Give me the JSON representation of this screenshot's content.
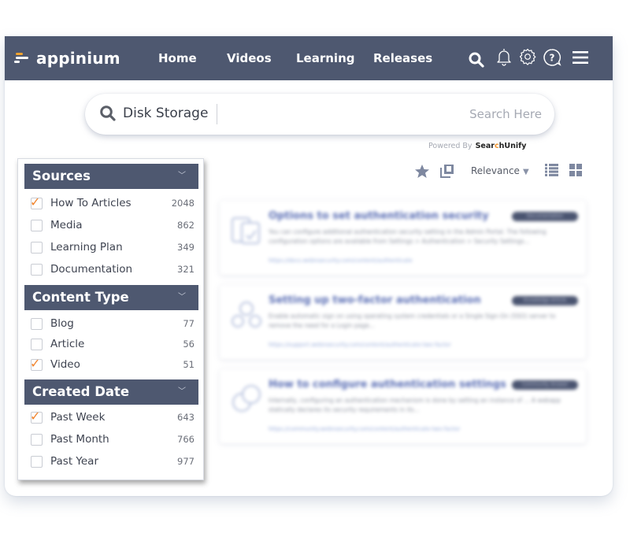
{
  "navbar": {
    "logo_text": "appinium",
    "links": [
      "Home",
      "Videos",
      "Learning",
      "Releases"
    ],
    "icons": [
      "search-icon",
      "bell-icon",
      "gear-icon",
      "help-icon",
      "menu-icon"
    ]
  },
  "search": {
    "value": "Disk Storage",
    "placeholder": "Search Here",
    "powered_by_label": "Powered By",
    "powered_by_brand_prefix": "Sear",
    "powered_by_brand_c": "c",
    "powered_by_brand_suffix": "hUnify"
  },
  "toolbar": {
    "icons": [
      "star-icon",
      "copy-icon",
      "list-view-icon",
      "grid-view-icon"
    ],
    "sort_label": "Relevance"
  },
  "filters": {
    "groups": [
      {
        "title": "Sources",
        "items": [
          {
            "label": "How To Articles",
            "count": "2048",
            "checked": true
          },
          {
            "label": "Media",
            "count": "862",
            "checked": false
          },
          {
            "label": "Learning Plan",
            "count": "349",
            "checked": false
          },
          {
            "label": "Documentation",
            "count": "321",
            "checked": false
          }
        ]
      },
      {
        "title": "Content Type",
        "items": [
          {
            "label": "Blog",
            "count": "77",
            "checked": false
          },
          {
            "label": "Article",
            "count": "56",
            "checked": false
          },
          {
            "label": "Video",
            "count": "51",
            "checked": true
          }
        ]
      },
      {
        "title": "Created Date",
        "items": [
          {
            "label": "Past Week",
            "count": "643",
            "checked": true
          },
          {
            "label": "Past Month",
            "count": "766",
            "checked": false
          },
          {
            "label": "Past Year",
            "count": "977",
            "checked": false
          }
        ]
      }
    ]
  },
  "results": [
    {
      "title": "Options to set authentication security",
      "badge": "Documentation",
      "description": "You can configure additional authentication security setting in the Admin Portal. The following configuration options are available from Settings > Authentication > Security Settings...",
      "link": "https://docs.webnsecurity.com/content/authenticate"
    },
    {
      "title": "Setting up two-factor authentication",
      "badge": "Knowledge Article",
      "description": "Enable automatic sign on using operating system credentials or a Single Sign-On (SSO) server to remove the need for a Login page...",
      "link": "https://support.webnsecurity.com/content/authenticate-two-factor"
    },
    {
      "title": "How to configure authentication settings",
      "badge": "Community Answer",
      "description": "Internally, configuring an authentication mechanism is done by setting an instance of ... A webapp statically declares its security requirements in its...",
      "link": "https://community.webnsecurity.com/content/authenticate-two-factor"
    }
  ],
  "colors": {
    "navbar_bg": "#4e5870",
    "accent_orange": "#f0842e",
    "link_blue": "#5b6fb5"
  }
}
